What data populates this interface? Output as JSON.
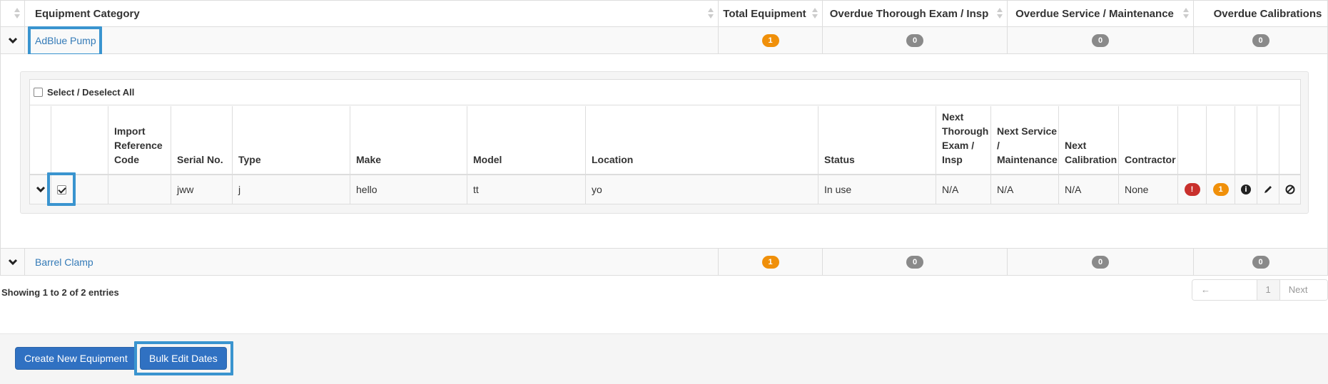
{
  "table": {
    "headers": {
      "category": "Equipment Category",
      "total": "Total Equipment",
      "overdue_exam": "Overdue Thorough Exam / Insp",
      "overdue_service": "Overdue Service / Maintenance",
      "overdue_calibrations": "Overdue Calibrations"
    },
    "rows": [
      {
        "category": "AdBlue Pump",
        "total": "1",
        "overdue_exam": "0",
        "overdue_service": "0",
        "overdue_calibrations": "0"
      },
      {
        "category": "Barrel Clamp",
        "total": "1",
        "overdue_exam": "0",
        "overdue_service": "0",
        "overdue_calibrations": "0"
      }
    ]
  },
  "detail": {
    "select_all_label": "Select / Deselect All",
    "headers": {
      "import_ref": "Import Reference Code",
      "serial": "Serial No.",
      "type": "Type",
      "make": "Make",
      "model": "Model",
      "location": "Location",
      "status": "Status",
      "next_exam": "Next Thorough Exam / Insp",
      "next_service": "Next Service / Maintenance",
      "next_calibration": "Next Calibration",
      "contractor": "Contractor"
    },
    "row": {
      "checked": true,
      "import_ref": "",
      "serial": "jww",
      "type": "j",
      "make": "hello",
      "model": "tt",
      "location": "yo",
      "status": "In use",
      "next_exam": "N/A",
      "next_service": "N/A",
      "next_calibration": "N/A",
      "contractor": "None",
      "alert_badge": "!",
      "count_badge": "1"
    }
  },
  "info_text": "Showing 1 to 2 of 2 entries",
  "pagination": {
    "previous": "← Previous",
    "page": "1",
    "next": "Next →"
  },
  "buttons": {
    "create": "Create New Equipment",
    "bulk_edit": "Bulk Edit Dates"
  },
  "colors": {
    "accent": "#337ab7",
    "highlight": "#3a94cf",
    "badge_orange": "#f0900a",
    "badge_grey": "#8a8a8a",
    "badge_red": "#c9302c",
    "button": "#3071c2"
  }
}
